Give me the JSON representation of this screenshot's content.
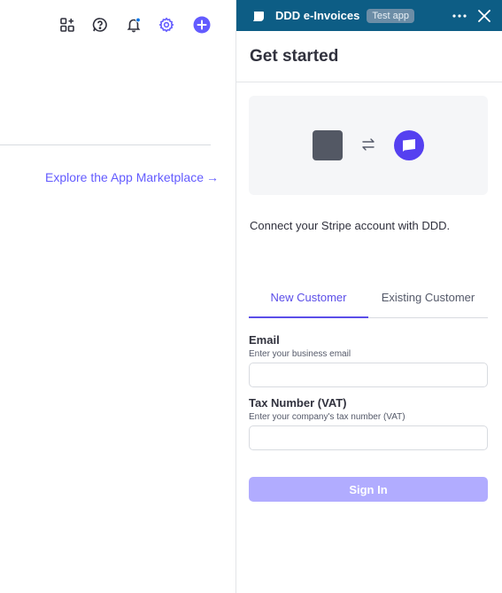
{
  "dashboard": {
    "marketplace_link": "Explore the App Marketplace",
    "marketplace_arrow": "→"
  },
  "drawer": {
    "app_name": "DDD e-Invoices",
    "badge": "Test app",
    "title": "Get started",
    "connect_text": "Connect your Stripe account with DDD.",
    "tabs": [
      {
        "label": "New Customer",
        "active": true
      },
      {
        "label": "Existing Customer",
        "active": false
      }
    ],
    "email": {
      "label": "Email",
      "help": "Enter your business email",
      "value": "",
      "placeholder": ""
    },
    "tax": {
      "label": "Tax Number (VAT)",
      "help": "Enter your company's tax number (VAT)",
      "value": "",
      "placeholder": ""
    },
    "signin_label": "Sign In"
  },
  "colors": {
    "accent": "#635bff",
    "header": "#0d5d85",
    "signin_disabled": "#b1acff"
  }
}
